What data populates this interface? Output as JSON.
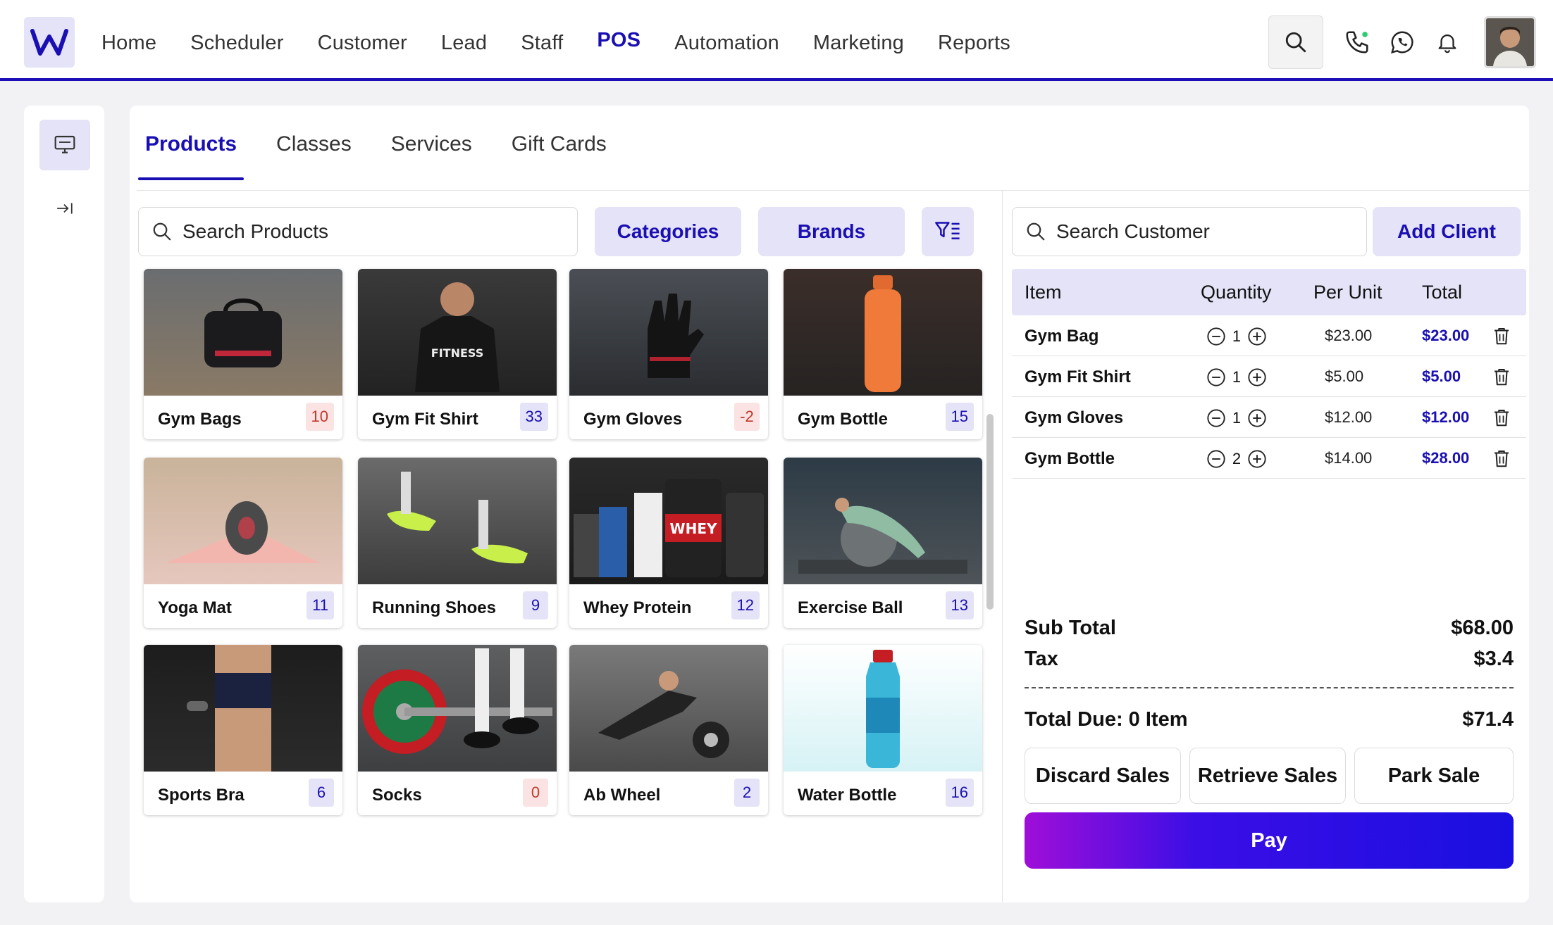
{
  "brand": {
    "logo_letter": "W",
    "accent": "#1a0fb2",
    "accent_bg": "#e4e3f7"
  },
  "nav": {
    "items": [
      {
        "label": "Home"
      },
      {
        "label": "Scheduler"
      },
      {
        "label": "Customer"
      },
      {
        "label": "Lead"
      },
      {
        "label": "Staff"
      },
      {
        "label": "POS"
      },
      {
        "label": "Automation"
      },
      {
        "label": "Marketing"
      },
      {
        "label": "Reports"
      }
    ],
    "active": "POS"
  },
  "header_icons": [
    "search-icon",
    "phone-icon",
    "whatsapp-icon",
    "bell-icon",
    "avatar"
  ],
  "tabs": [
    {
      "label": "Products"
    },
    {
      "label": "Classes"
    },
    {
      "label": "Services"
    },
    {
      "label": "Gift Cards"
    }
  ],
  "product_search": {
    "placeholder": "Search Products"
  },
  "filters": {
    "categories": "Categories",
    "brands": "Brands"
  },
  "products": [
    {
      "name": "Gym Bags",
      "count": "10",
      "negative": false
    },
    {
      "name": "Gym Fit Shirt",
      "count": "33",
      "negative": false
    },
    {
      "name": "Gym Gloves",
      "count": "-2",
      "negative": true
    },
    {
      "name": "Gym Bottle",
      "count": "15",
      "negative": false
    },
    {
      "name": "Yoga Mat",
      "count": "11",
      "negative": false
    },
    {
      "name": "Running Shoes",
      "count": "9",
      "negative": false
    },
    {
      "name": "Whey Protein",
      "count": "12",
      "negative": false
    },
    {
      "name": "Exercise Ball",
      "count": "13",
      "negative": false
    },
    {
      "name": "Sports Bra",
      "count": "6",
      "negative": false
    },
    {
      "name": "Socks",
      "count": "0",
      "negative": true
    },
    {
      "name": "Ab Wheel",
      "count": "2",
      "negative": false
    },
    {
      "name": "Water Bottle",
      "count": "16",
      "negative": false
    }
  ],
  "customer_search": {
    "placeholder": "Search Customer"
  },
  "add_client": "Add Client",
  "cart": {
    "headers": {
      "item": "Item",
      "quantity": "Quantity",
      "per_unit": "Per Unit",
      "total": "Total"
    },
    "rows": [
      {
        "item": "Gym Bag",
        "qty": "1",
        "unit": "$23.00",
        "total": "$23.00"
      },
      {
        "item": "Gym Fit Shirt",
        "qty": "1",
        "unit": "$5.00",
        "total": "$5.00"
      },
      {
        "item": "Gym Gloves",
        "qty": "1",
        "unit": "$12.00",
        "total": "$12.00"
      },
      {
        "item": "Gym Bottle",
        "qty": "2",
        "unit": "$14.00",
        "total": "$28.00"
      }
    ]
  },
  "summary": {
    "subtotal_label": "Sub Total",
    "subtotal": "$68.00",
    "tax_label": "Tax",
    "tax": "$3.4",
    "total_label": "Total Due: 0 Item",
    "total": "$71.4"
  },
  "actions": {
    "discard": "Discard Sales",
    "retrieve": "Retrieve Sales",
    "park": "Park Sale",
    "pay": "Pay"
  }
}
